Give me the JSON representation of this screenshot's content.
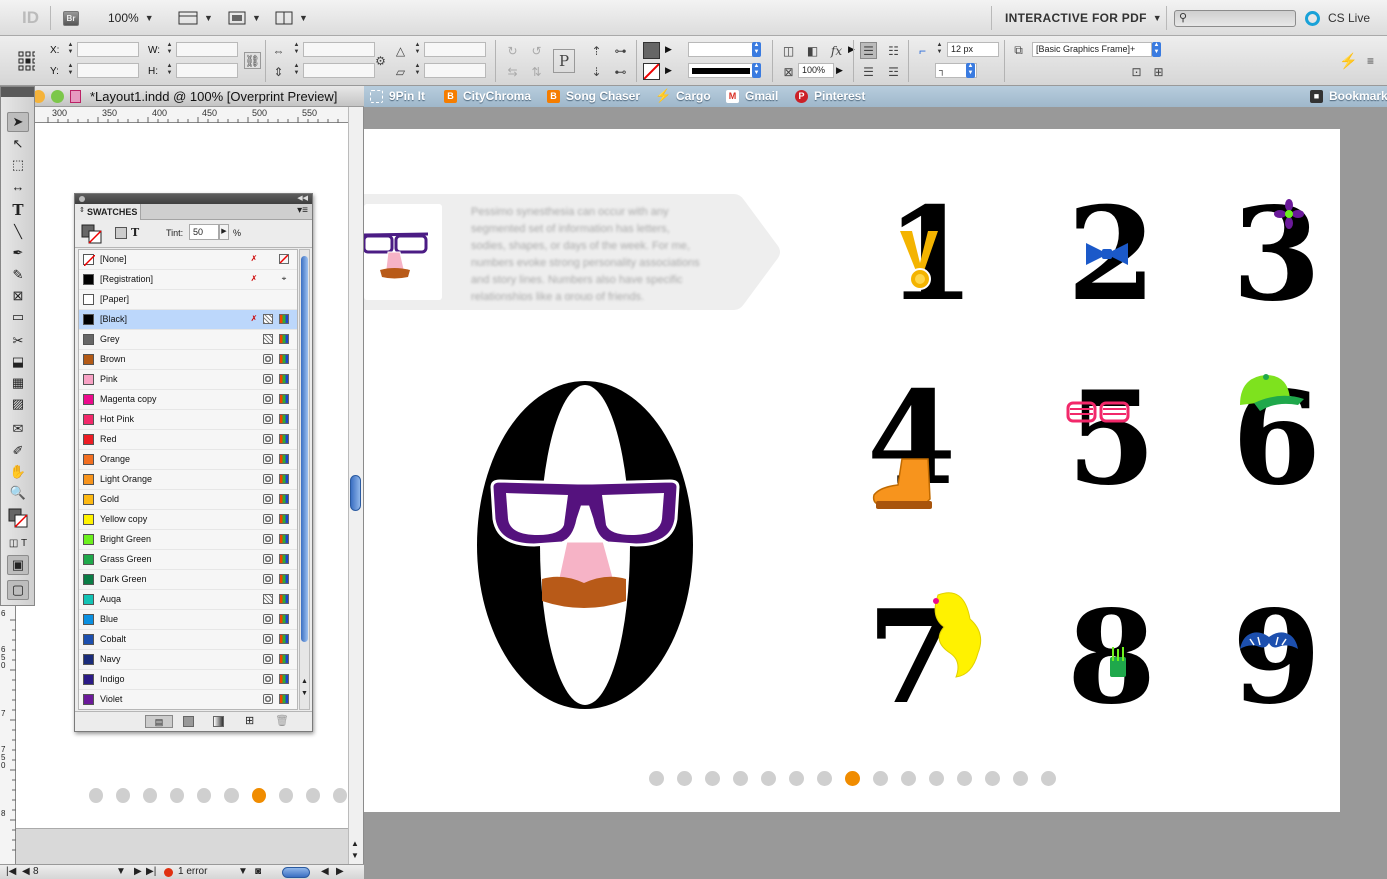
{
  "app": {
    "logo": "ID",
    "bridge_label": "Br",
    "zoom": "100%",
    "workspace": "INTERACTIVE FOR PDF",
    "cs_live": "CS Live"
  },
  "control_bar": {
    "x_label": "X:",
    "y_label": "Y:",
    "w_label": "W:",
    "h_label": "H:",
    "stroke_weight": "12 px",
    "scale_percent": "100%",
    "object_style": "[Basic Graphics Frame]+",
    "accent_color": "#2f5fd0"
  },
  "document": {
    "title": "*Layout1.indd @ 100% [Overprint Preview]",
    "ruler_ticks": [
      "300",
      "350",
      "400",
      "450",
      "500",
      "550"
    ],
    "vruler_ticks": [
      "6",
      "6 5 0",
      "7",
      "7 5 0",
      "8"
    ],
    "page_number": "8",
    "errors": "1 error"
  },
  "bookmarks": [
    {
      "label": "9Pin It",
      "icon": "pin-icon",
      "color": "#7aa0bd"
    },
    {
      "label": "CityChroma",
      "icon": "blogger-icon",
      "color": "#f57d00"
    },
    {
      "label": "Song Chaser",
      "icon": "blogger-icon",
      "color": "#f57d00"
    },
    {
      "label": "Cargo",
      "icon": "bolt-icon",
      "color": "#222222"
    },
    {
      "label": "Gmail",
      "icon": "gmail-icon",
      "color": "#d93025"
    },
    {
      "label": "Pinterest",
      "icon": "pinterest-icon",
      "color": "#cb2027"
    },
    {
      "label": "Bookmarks",
      "icon": "bookmarks-icon",
      "color": "#444444"
    }
  ],
  "swatches": {
    "tab_label": "SWATCHES",
    "tint_label": "Tint:",
    "tint_value": "50",
    "tint_unit": "%",
    "items": [
      {
        "name": "[None]",
        "color": "none",
        "lock": true,
        "kind": "none"
      },
      {
        "name": "[Registration]",
        "color": "#000000",
        "lock": true,
        "kind": "reg"
      },
      {
        "name": "[Paper]",
        "color": "#ffffff",
        "lock": false,
        "kind": "blank"
      },
      {
        "name": "[Black]",
        "color": "#000000",
        "lock": true,
        "kind": "spot",
        "selected": true
      },
      {
        "name": "Grey",
        "color": "#666666",
        "lock": false,
        "kind": "spot"
      },
      {
        "name": "Brown",
        "color": "#b35a16",
        "lock": false,
        "kind": "proc"
      },
      {
        "name": "Pink",
        "color": "#f7a1c4",
        "lock": false,
        "kind": "proc"
      },
      {
        "name": "Magenta copy",
        "color": "#ec0a8c",
        "lock": false,
        "kind": "proc"
      },
      {
        "name": "Hot Pink",
        "color": "#f2286a",
        "lock": false,
        "kind": "proc"
      },
      {
        "name": "Red",
        "color": "#ed1c24",
        "lock": false,
        "kind": "proc"
      },
      {
        "name": "Orange",
        "color": "#f26f21",
        "lock": false,
        "kind": "proc"
      },
      {
        "name": "Light Orange",
        "color": "#f7941d",
        "lock": false,
        "kind": "proc"
      },
      {
        "name": "Gold",
        "color": "#fdb913",
        "lock": false,
        "kind": "proc"
      },
      {
        "name": "Yellow copy",
        "color": "#fff200",
        "lock": false,
        "kind": "proc"
      },
      {
        "name": "Bright Green",
        "color": "#6cf01e",
        "lock": false,
        "kind": "proc"
      },
      {
        "name": "Grass Green",
        "color": "#1fa84b",
        "lock": false,
        "kind": "proc"
      },
      {
        "name": "Dark Green",
        "color": "#0b7d46",
        "lock": false,
        "kind": "proc"
      },
      {
        "name": "Auqa",
        "color": "#12c2b4",
        "lock": false,
        "kind": "spot"
      },
      {
        "name": "Blue",
        "color": "#0a8fe0",
        "lock": false,
        "kind": "proc"
      },
      {
        "name": "Cobalt",
        "color": "#1c4fae",
        "lock": false,
        "kind": "proc"
      },
      {
        "name": "Navy",
        "color": "#1a2c7a",
        "lock": false,
        "kind": "proc"
      },
      {
        "name": "Indigo",
        "color": "#2b1a86",
        "lock": false,
        "kind": "proc"
      },
      {
        "name": "Violet",
        "color": "#6b1a9a",
        "lock": false,
        "kind": "proc"
      }
    ]
  },
  "page": {
    "callout_text": "Pessimo synesthesia can occur with any segmented set of information has letters, sodies, shapes, or days of the week. For me, numbers evoke strong personality associations and story lines. Numbers also have specific relationships like a group of friends.",
    "big_digit": "0",
    "digits": [
      "1",
      "2",
      "3",
      "4",
      "5",
      "6",
      "7",
      "8",
      "9"
    ],
    "pagination_count": 15,
    "pagination_active": 7
  }
}
